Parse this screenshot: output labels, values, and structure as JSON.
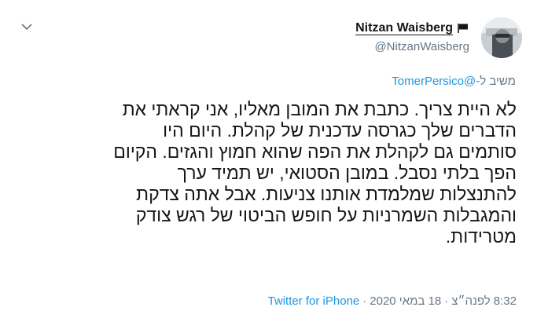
{
  "author": {
    "display_name": "Nitzan Waisberg",
    "handle": "@NitzanWaisberg"
  },
  "reply": {
    "prefix": "משיב ל-",
    "to": "TomerPersico@"
  },
  "tweet": {
    "lines": [
      "לא היית צריך. כתבת את המובן מאליו, אני קראתי את",
      "הדברים שלך כגרסה עדכנית של קהלת. היום היו",
      "סותמים גם לקהלת את הפה שהוא חמוץ והגזים. הקיום",
      "הפך בלתי נסבל. במובן הסטואי, יש תמיד ערך",
      "להתנצלות שמלמדת אותנו צניעות. אבל אתה צדקת",
      "והמגבלות השמרניות על חופש הביטוי של רגש צודק",
      "מטרידות."
    ]
  },
  "meta": {
    "time": "8:32 לפנה״צ",
    "date": "18 במאי 2020",
    "separator_1": "·",
    "separator_2": "·",
    "source": "Twitter for iPhone"
  },
  "icons": {
    "caret": "chevron-down-icon",
    "flag": "black-flag-icon",
    "avatar": "profile-photo"
  },
  "colors": {
    "link": "#1b95e0",
    "secondary_text": "#657786",
    "primary_text": "#14171a"
  }
}
